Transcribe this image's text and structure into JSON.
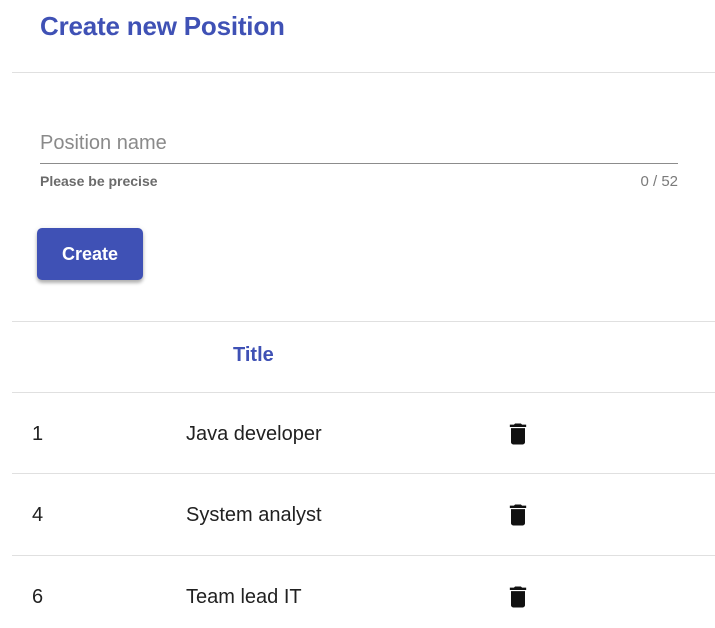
{
  "header": {
    "title": "Create new Position"
  },
  "form": {
    "position_name": {
      "placeholder": "Position name",
      "value": "",
      "hint": "Please be precise",
      "counter": "0 / 52"
    },
    "create_label": "Create"
  },
  "table": {
    "columns": [
      "",
      "Title",
      ""
    ],
    "rows": [
      {
        "id": "1",
        "title": "Java developer",
        "action_icon": "trash-icon"
      },
      {
        "id": "4",
        "title": "System analyst",
        "action_icon": "trash-icon"
      },
      {
        "id": "6",
        "title": "Team lead IT",
        "action_icon": "trash-icon"
      }
    ]
  },
  "colors": {
    "primary": "#3f51b5",
    "divider": "#e0e0e0",
    "text": "#212121",
    "hint": "#6b6b6b"
  }
}
